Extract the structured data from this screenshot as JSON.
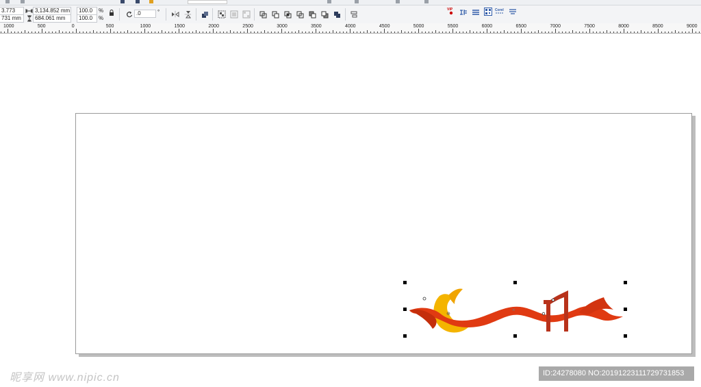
{
  "menu": {
    "partial_items": [
      "",
      "",
      "",
      "",
      ""
    ]
  },
  "properties": {
    "x_value": "3.773 mm",
    "y_value": "731 mm",
    "width_value": "3,134.852 mm",
    "height_value": "684.061 mm",
    "scale_x": "100.0",
    "scale_y": "100.0",
    "percent_x": "%",
    "percent_y": "%",
    "rotation": ".0",
    "degree": "°"
  },
  "plugins": {
    "vip": "VIP",
    "corel": "Corel"
  },
  "ruler": {
    "labels": [
      "1000",
      "500",
      "0",
      "500",
      "1000",
      "1500",
      "2000",
      "2500",
      "3000",
      "3500",
      "4000",
      "4500",
      "5000",
      "5500",
      "6000",
      "6500",
      "7000",
      "7500",
      "8000",
      "8500",
      "9000"
    ]
  },
  "watermark": {
    "left_text": "昵享网 www.nipic.cn",
    "right_text": "ID:24278080 NO:20191223111729731853"
  },
  "colors": {
    "ribbon_red": "#e03a12",
    "emblem_yellow": "#f4b400",
    "dark_red": "#b8321b"
  }
}
